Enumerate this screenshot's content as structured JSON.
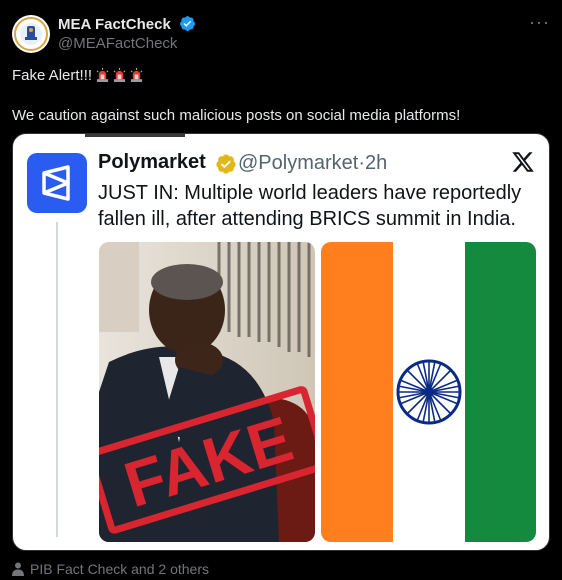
{
  "post": {
    "author_name": "MEA FactCheck",
    "author_handle": "@MEAFactCheck",
    "text_line1": "Fake Alert!!!",
    "text_line2": "We caution against such malicious posts on social media platforms!"
  },
  "embedded": {
    "name": "Polymarket",
    "handle": "@Polymarket",
    "separator": "·",
    "time": "2h",
    "text": "JUST IN: Multiple world leaders have reportedly fallen ill, after attending BRICS summit in India.",
    "stamp_text": "FAKE",
    "flag_colors": {
      "saffron": "#ff7f1f",
      "white": "#ffffff",
      "green": "#138a3e",
      "chakra": "#0b2a86"
    }
  },
  "footer": {
    "tagged": "PIB Fact Check and 2 others"
  },
  "colors": {
    "background": "#000000",
    "text_primary": "#e7e9ea",
    "text_secondary": "#71767b",
    "verified_blue": "#1d9bf0",
    "verified_gold": "#e2b719",
    "polymarket_blue": "#2b5cf2",
    "stamp_red": "#d9252f"
  }
}
